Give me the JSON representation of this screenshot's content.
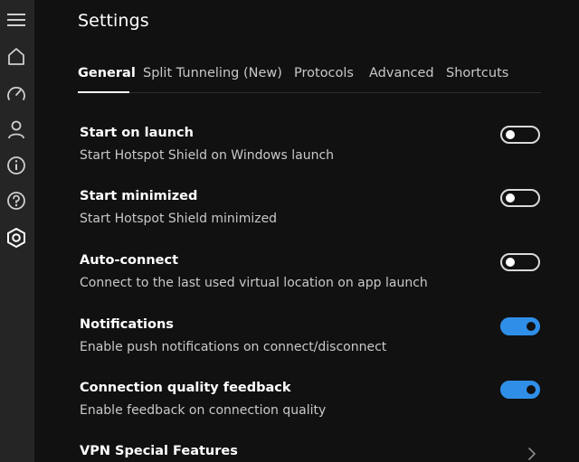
{
  "page": {
    "title": "Settings"
  },
  "sidebar": {
    "icons": [
      "menu-icon",
      "home-icon",
      "speed-icon",
      "account-icon",
      "info-icon",
      "help-icon",
      "settings-icon"
    ],
    "active_icon": "settings-icon"
  },
  "tabs": [
    {
      "label": "General",
      "active": true
    },
    {
      "label": "Split Tunneling (New)",
      "active": false
    },
    {
      "label": "Protocols",
      "active": false
    },
    {
      "label": "Advanced",
      "active": false
    },
    {
      "label": "Shortcuts",
      "active": false
    }
  ],
  "settings": [
    {
      "title": "Start on launch",
      "description": "Start Hotspot Shield on Windows launch",
      "enabled": false
    },
    {
      "title": "Start minimized",
      "description": "Start Hotspot Shield minimized",
      "enabled": false
    },
    {
      "title": "Auto-connect",
      "description": "Connect to the last used virtual location on app launch",
      "enabled": false
    },
    {
      "title": "Notifications",
      "description": "Enable push notifications on connect/disconnect",
      "enabled": true
    },
    {
      "title": "Connection quality feedback",
      "description": "Enable feedback on connection quality",
      "enabled": true
    }
  ],
  "special_features": {
    "label": "VPN Special Features",
    "icon": "chevron-right-icon"
  },
  "colors": {
    "background": "#111111",
    "sidebar": "#252525",
    "accent": "#2f8fe8",
    "text": "#ffffff",
    "muted_text": "#c9c9c9"
  }
}
